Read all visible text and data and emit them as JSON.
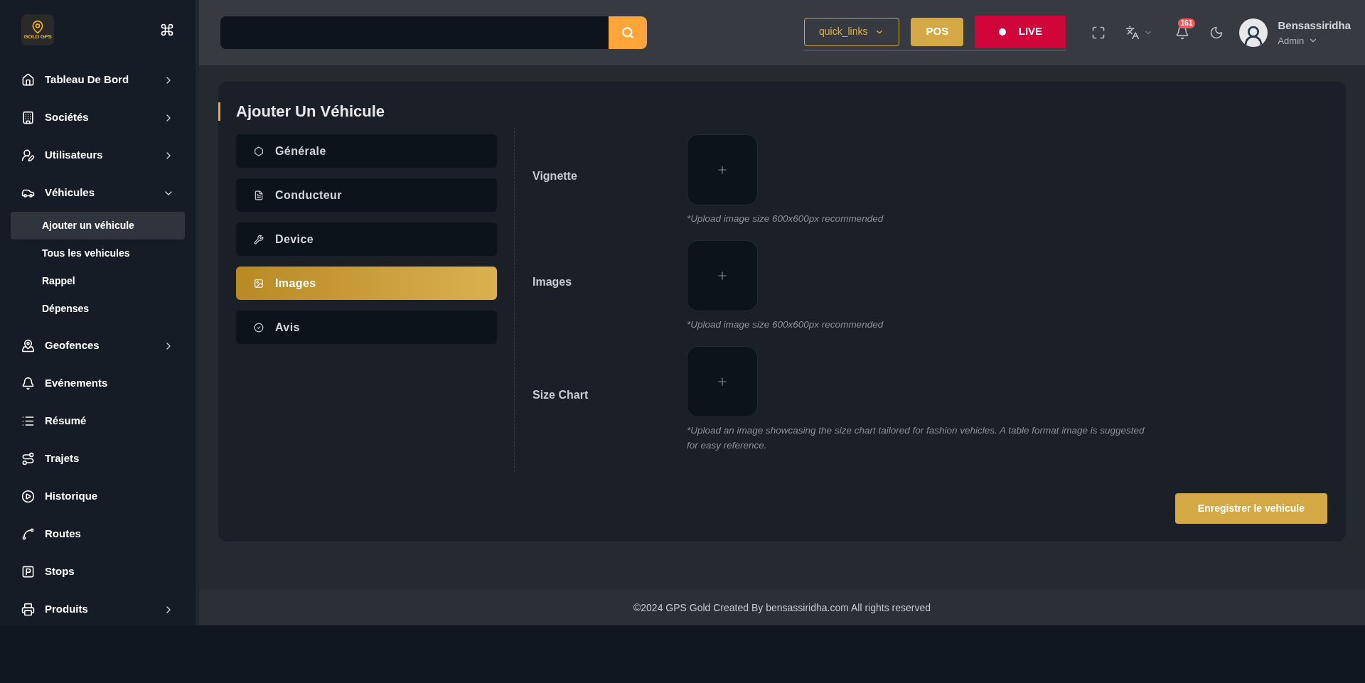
{
  "logo": {
    "text": "GOLD GPS"
  },
  "sidebar": {
    "items": [
      {
        "label": "Tableau De Bord",
        "kind": "group",
        "expanded": false
      },
      {
        "label": "Sociétés",
        "kind": "group",
        "expanded": false
      },
      {
        "label": "Utilisateurs",
        "kind": "group",
        "expanded": false
      },
      {
        "label": "Véhicules",
        "kind": "group",
        "expanded": true,
        "children": [
          {
            "label": "Ajouter un véhicule",
            "selected": true
          },
          {
            "label": "Tous les vehicules",
            "selected": false
          },
          {
            "label": "Rappel",
            "selected": false
          },
          {
            "label": "Dépenses",
            "selected": false
          }
        ]
      },
      {
        "label": "Geofences",
        "kind": "group",
        "expanded": false
      },
      {
        "label": "Evénements",
        "kind": "link"
      },
      {
        "label": "Résumé",
        "kind": "link"
      },
      {
        "label": "Trajets",
        "kind": "link"
      },
      {
        "label": "Historique",
        "kind": "link"
      },
      {
        "label": "Routes",
        "kind": "link"
      },
      {
        "label": "Stops",
        "kind": "link"
      },
      {
        "label": "Produits",
        "kind": "group",
        "expanded": false
      }
    ]
  },
  "header": {
    "quick_links": "quick_links",
    "pos": "POS",
    "live": "LIVE",
    "notification_count": "161",
    "user": {
      "name": "Bensassiridha",
      "role": "Admin"
    }
  },
  "page": {
    "title": "Ajouter Un Véhicule",
    "tabs": [
      {
        "label": "Générale",
        "selected": false
      },
      {
        "label": "Conducteur",
        "selected": false
      },
      {
        "label": "Device",
        "selected": false
      },
      {
        "label": "Images",
        "selected": true
      },
      {
        "label": "Avis",
        "selected": false
      }
    ],
    "fields": [
      {
        "label": "Vignette",
        "hint": "*Upload image size 600x600px recommended"
      },
      {
        "label": "Images",
        "hint": "*Upload image size 600x600px recommended"
      },
      {
        "label": "Size Chart",
        "hint": "*Upload an image showcasing the size chart tailored for fashion vehicles. A table format image is suggested for easy reference."
      }
    ],
    "save_button": "Enregistrer le vehicule"
  },
  "footer": "©2024 GPS Gold Created By bensassiridha.com All rights reserved"
}
